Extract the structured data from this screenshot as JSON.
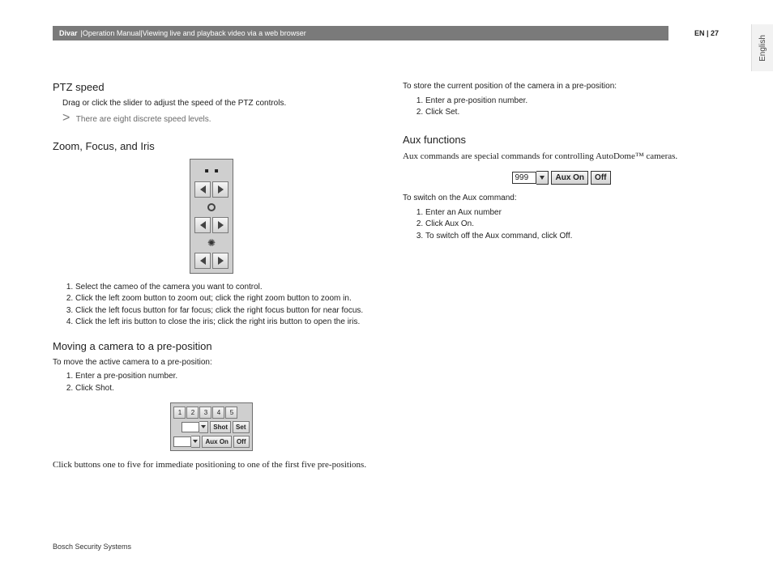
{
  "sidebar_lang": "English",
  "header": {
    "brand": "Divar",
    "sep1": " | ",
    "doc": "Operation Manual",
    "sep2": " | ",
    "section": "Viewing live and playback video via a web browser",
    "page_label": "EN | 27"
  },
  "left": {
    "ptz_title": "PTZ speed",
    "ptz_text": "Drag or click the slider to adjust the speed of the PTZ controls.",
    "ptz_note": "There are eight discrete speed levels.",
    "zfi_title": "Zoom, Focus, and Iris",
    "zfi_steps": [
      "Select the cameo of the camera you want to control.",
      "Click the left zoom button to zoom out; click the right zoom button to zoom in.",
      "Click the left focus button for far focus; click the right focus button for near focus.",
      "Click the left iris button to close the iris; click the right iris button to open the iris."
    ],
    "pre_title": "Moving a camera to a pre-position",
    "pre_intro": "To move the active camera to a pre-position:",
    "pre_steps": [
      "Enter a pre-position number.",
      "Click Shot."
    ],
    "preset_buttons": [
      "1",
      "2",
      "3",
      "4",
      "5"
    ],
    "preset_shot": "Shot",
    "preset_set": "Set",
    "preset_auxon": "Aux On",
    "preset_off": "Off",
    "pre_footer": "Click buttons one to five for immediate positioning to one of the first five pre-positions."
  },
  "right": {
    "store_intro": "To store the current position of the camera in a pre-position:",
    "store_steps": [
      "Enter a pre-position number.",
      "Click Set."
    ],
    "aux_title": "Aux functions",
    "aux_intro": "Aux commands are special commands for controlling AutoDome™ cameras.",
    "aux_value": "999",
    "aux_on": "Aux On",
    "aux_off": "Off",
    "switch_intro": "To switch on the Aux command:",
    "switch_steps": [
      "Enter an Aux number",
      "Click Aux On.",
      "To switch off the Aux command, click Off."
    ]
  },
  "footer": "Bosch Security Systems"
}
